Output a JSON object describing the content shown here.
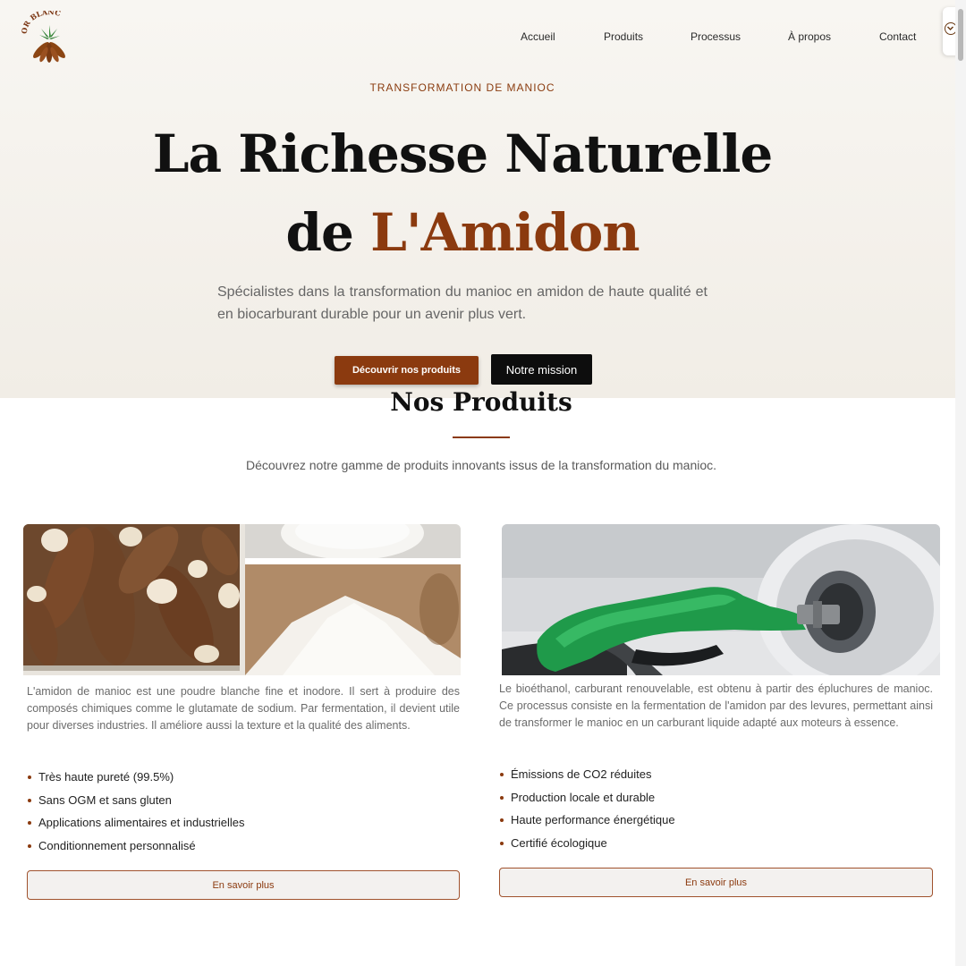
{
  "brand": {
    "logo_text": "OR BLANC"
  },
  "nav": {
    "items": [
      "Accueil",
      "Produits",
      "Processus",
      "À propos",
      "Contact"
    ]
  },
  "hero": {
    "eyebrow": "TRANSFORMATION DE MANIOC",
    "title_line1": "La Richesse Naturelle",
    "title_line2_prefix": "de ",
    "title_line2_accent": "L'Amidon",
    "subtitle": "Spécialistes dans la transformation du manioc en amidon de haute qualité et en biocarburant durable pour un avenir plus vert.",
    "primary_button": "Découvrir nos produits",
    "secondary_button": "Notre mission"
  },
  "products": {
    "title": "Nos Produits",
    "subtitle": "Découvrez notre gamme de produits innovants issus de la transformation du manioc.",
    "cards": [
      {
        "description": "L'amidon de manioc est une poudre blanche fine et inodore. Il sert à produire des composés chimiques comme le glutamate de sodium. Par fermentation, il devient utile pour diverses industries. Il améliore aussi la texture et la qualité des aliments.",
        "features": [
          "Très haute pureté (99.5%)",
          "Sans OGM et sans gluten",
          "Applications alimentaires et industrielles",
          "Conditionnement personnalisé"
        ],
        "button": "En savoir plus"
      },
      {
        "description": "Le bioéthanol, carburant renouvelable, est obtenu à partir des épluchures de manioc. Ce processus consiste en la fermentation de l'amidon par des levures, permettant ainsi de transformer le manioc en un carburant liquide adapté aux moteurs à essence.",
        "features": [
          "Émissions de CO2 réduites",
          "Production locale et durable",
          "Haute performance énergétique",
          "Certifié écologique"
        ],
        "button": "En savoir plus"
      }
    ]
  },
  "colors": {
    "accent": "#8b3a0f",
    "dark": "#0d0d0d",
    "hero_bg": "#f4f1eb"
  }
}
